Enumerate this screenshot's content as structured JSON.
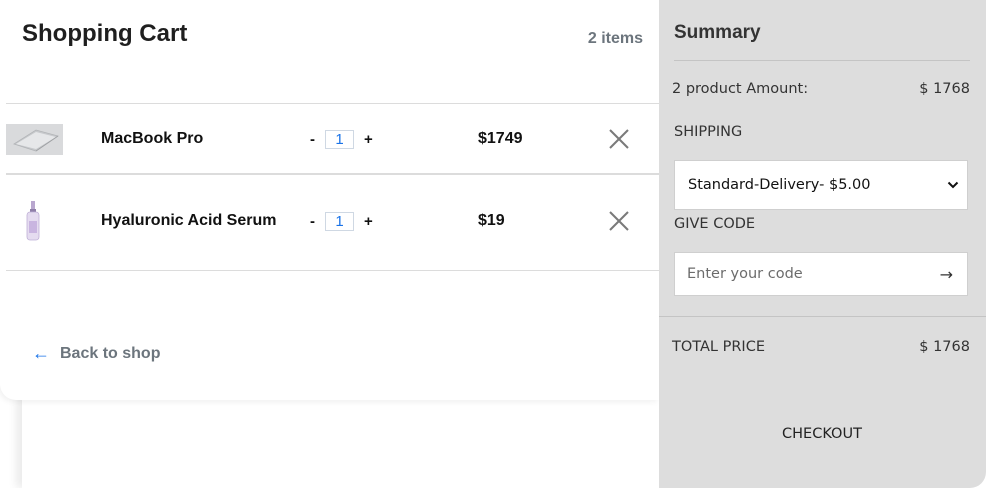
{
  "cart": {
    "title": "Shopping Cart",
    "count_label": "2 items",
    "items": [
      {
        "name": "MacBook Pro",
        "quantity": "1",
        "price": "$1749",
        "minus": "-",
        "plus": "+"
      },
      {
        "name": "Hyaluronic Acid Serum",
        "quantity": "1",
        "price": "$19",
        "minus": "-",
        "plus": "+"
      }
    ],
    "back_label": "Back to shop",
    "back_icon": "arrow-left-icon"
  },
  "summary": {
    "title": "Summary",
    "amount_label": "2 product Amount:",
    "amount_value": "$ 1768",
    "shipping_label": "SHIPPING",
    "shipping_selected": "Standard-Delivery- $5.00",
    "code_label": "GIVE CODE",
    "code_placeholder": "Enter your code",
    "code_submit_icon": "arrow-right-icon",
    "total_label": "TOTAL PRICE",
    "total_value": "$ 1768",
    "checkout_label": "CHECKOUT"
  },
  "colors": {
    "accent": "#1a73e8",
    "summary_bg": "#dddddd",
    "muted_text": "#6c757d"
  }
}
